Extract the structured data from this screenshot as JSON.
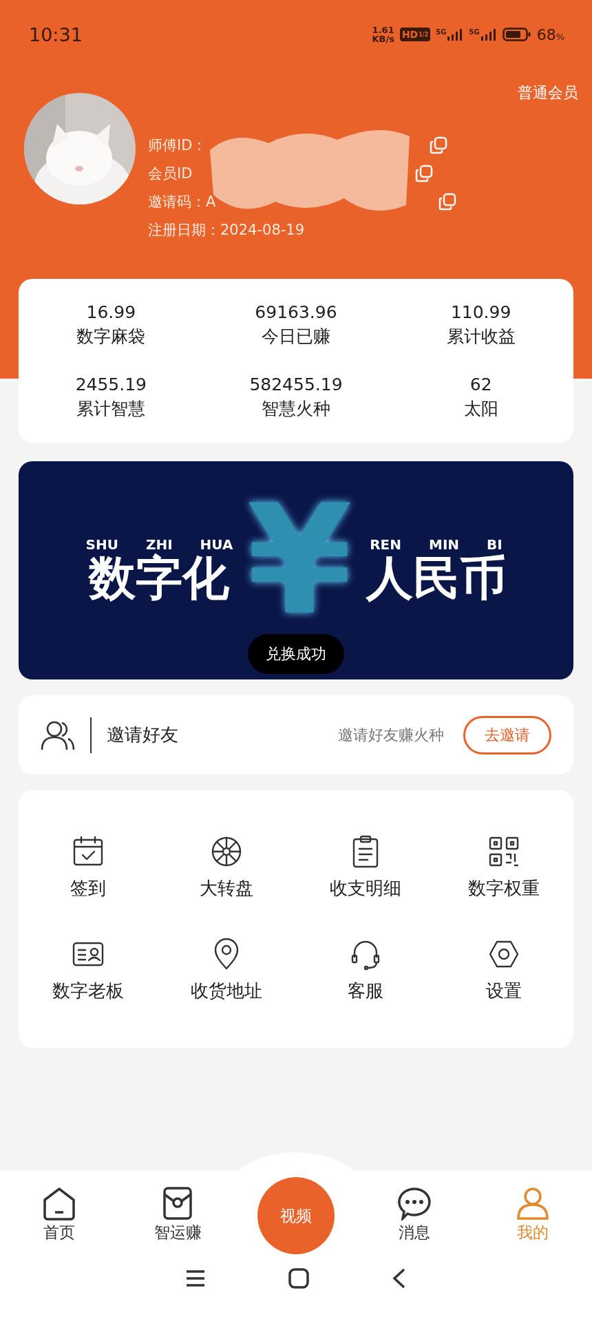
{
  "status_bar": {
    "time": "10:31",
    "net_speed": "1.61",
    "net_unit": "KB/s",
    "hd": "HD",
    "hd_sub": "1/2",
    "networks": [
      "5G",
      "5G"
    ],
    "battery_percent": "68",
    "percent_sign": "%"
  },
  "profile": {
    "member_level": "普通会员",
    "fields": [
      {
        "label": "师傅ID：",
        "copyable": true
      },
      {
        "label": "会员ID",
        "copyable": true
      },
      {
        "label": "邀请码：A",
        "copyable": true
      },
      {
        "label": "注册日期：2024-08-19",
        "copyable": false
      }
    ]
  },
  "stats": [
    {
      "value": "16.99",
      "label": "数字麻袋"
    },
    {
      "value": "69163.96",
      "label": "今日已赚"
    },
    {
      "value": "110.99",
      "label": "累计收益"
    },
    {
      "value": "2455.19",
      "label": "累计智慧"
    },
    {
      "value": "582455.19",
      "label": "智慧火种"
    },
    {
      "value": "62",
      "label": "太阳"
    }
  ],
  "banner": {
    "left_pinyin": [
      "SHU",
      "ZHI",
      "HUA"
    ],
    "left_title": "数字化",
    "symbol": "¥",
    "right_pinyin": [
      "REN",
      "MIN",
      "BI"
    ],
    "right_title": "人民币",
    "toast": "兑换成功"
  },
  "invite": {
    "title": "邀请好友",
    "hint": "邀请好友赚火种",
    "button": "去邀请"
  },
  "features": [
    {
      "label": "签到"
    },
    {
      "label": "大转盘"
    },
    {
      "label": "收支明细"
    },
    {
      "label": "数字权重"
    },
    {
      "label": "数字老板"
    },
    {
      "label": "收货地址"
    },
    {
      "label": "客服"
    },
    {
      "label": "设置"
    }
  ],
  "tabs": [
    {
      "label": "首页",
      "selected": false
    },
    {
      "label": "智运赚",
      "selected": false
    },
    {
      "label": "消息",
      "selected": false
    },
    {
      "label": "我的",
      "selected": true
    }
  ],
  "center_button": "视频"
}
